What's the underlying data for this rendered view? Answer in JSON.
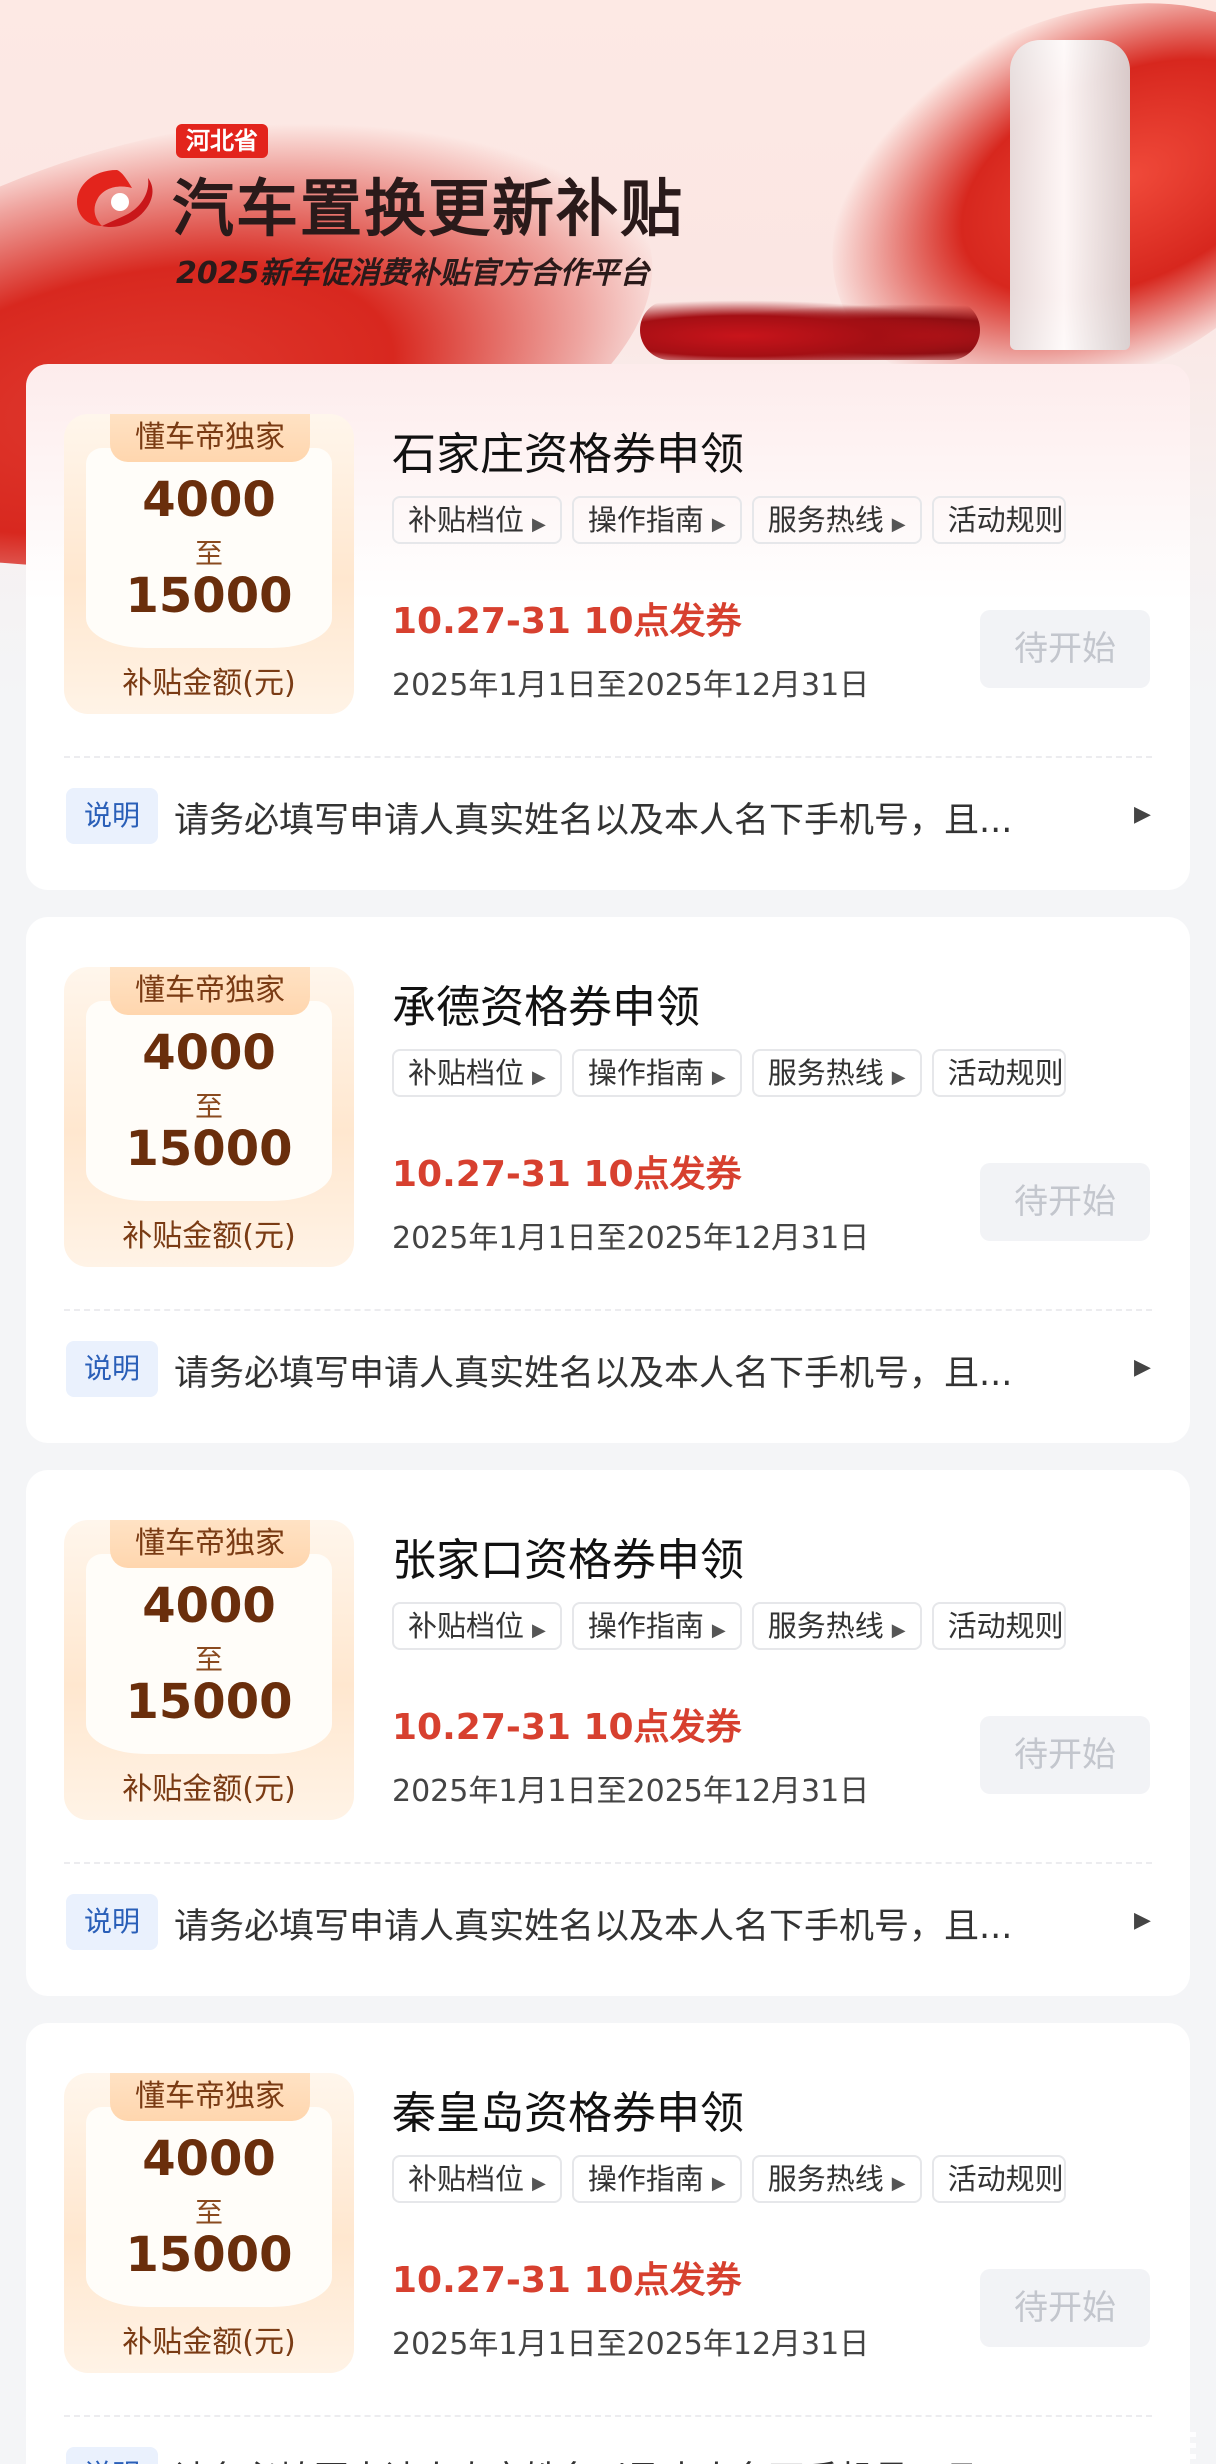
{
  "banner": {
    "province": "河北省",
    "title": "汽车置换更新补贴",
    "subtitle": "2025新车促消费补贴官方合作平台"
  },
  "cards": [
    {
      "exclusive_tag": "懂车帝独家",
      "amount_min": "4000",
      "amount_to": "至",
      "amount_max": "15000",
      "amount_caption": "补贴金额(元)",
      "title": "石家庄资格券申领",
      "tags": [
        "补贴档位",
        "操作指南",
        "服务热线",
        "活动规则"
      ],
      "issue_time": "10.27-31 10点发券",
      "date_range": "2025年1月1日至2025年12月31日",
      "button": "待开始",
      "note_label": "说明",
      "note_text": "请务必填写申请人真实姓名以及本人名下手机号，且..."
    },
    {
      "exclusive_tag": "懂车帝独家",
      "amount_min": "4000",
      "amount_to": "至",
      "amount_max": "15000",
      "amount_caption": "补贴金额(元)",
      "title": "承德资格券申领",
      "tags": [
        "补贴档位",
        "操作指南",
        "服务热线",
        "活动规则"
      ],
      "issue_time": "10.27-31 10点发券",
      "date_range": "2025年1月1日至2025年12月31日",
      "button": "待开始",
      "note_label": "说明",
      "note_text": "请务必填写申请人真实姓名以及本人名下手机号，且..."
    },
    {
      "exclusive_tag": "懂车帝独家",
      "amount_min": "4000",
      "amount_to": "至",
      "amount_max": "15000",
      "amount_caption": "补贴金额(元)",
      "title": "张家口资格券申领",
      "tags": [
        "补贴档位",
        "操作指南",
        "服务热线",
        "活动规则"
      ],
      "issue_time": "10.27-31 10点发券",
      "date_range": "2025年1月1日至2025年12月31日",
      "button": "待开始",
      "note_label": "说明",
      "note_text": "请务必填写申请人真实姓名以及本人名下手机号，且..."
    },
    {
      "exclusive_tag": "懂车帝独家",
      "amount_min": "4000",
      "amount_to": "至",
      "amount_max": "15000",
      "amount_caption": "补贴金额(元)",
      "title": "秦皇岛资格券申领",
      "tags": [
        "补贴档位",
        "操作指南",
        "服务热线",
        "活动规则"
      ],
      "issue_time": "10.27-31 10点发券",
      "date_range": "2025年1月1日至2025年12月31日",
      "button": "待开始",
      "note_label": "说明",
      "note_text": "请务必填写申请人真实姓名以及本人名下手机号，且..."
    }
  ],
  "colors": {
    "accent_red": "#e3241c",
    "issue_time": "#d7402f",
    "amount_brown": "#6a2e0c",
    "note_blue": "#2a5fb8",
    "button_disabled": "#c3c6cd"
  },
  "icons": {
    "logo": "brand-logo-icon",
    "tag_arrow": "triangle-right-icon",
    "note_arrow": "triangle-right-icon"
  }
}
